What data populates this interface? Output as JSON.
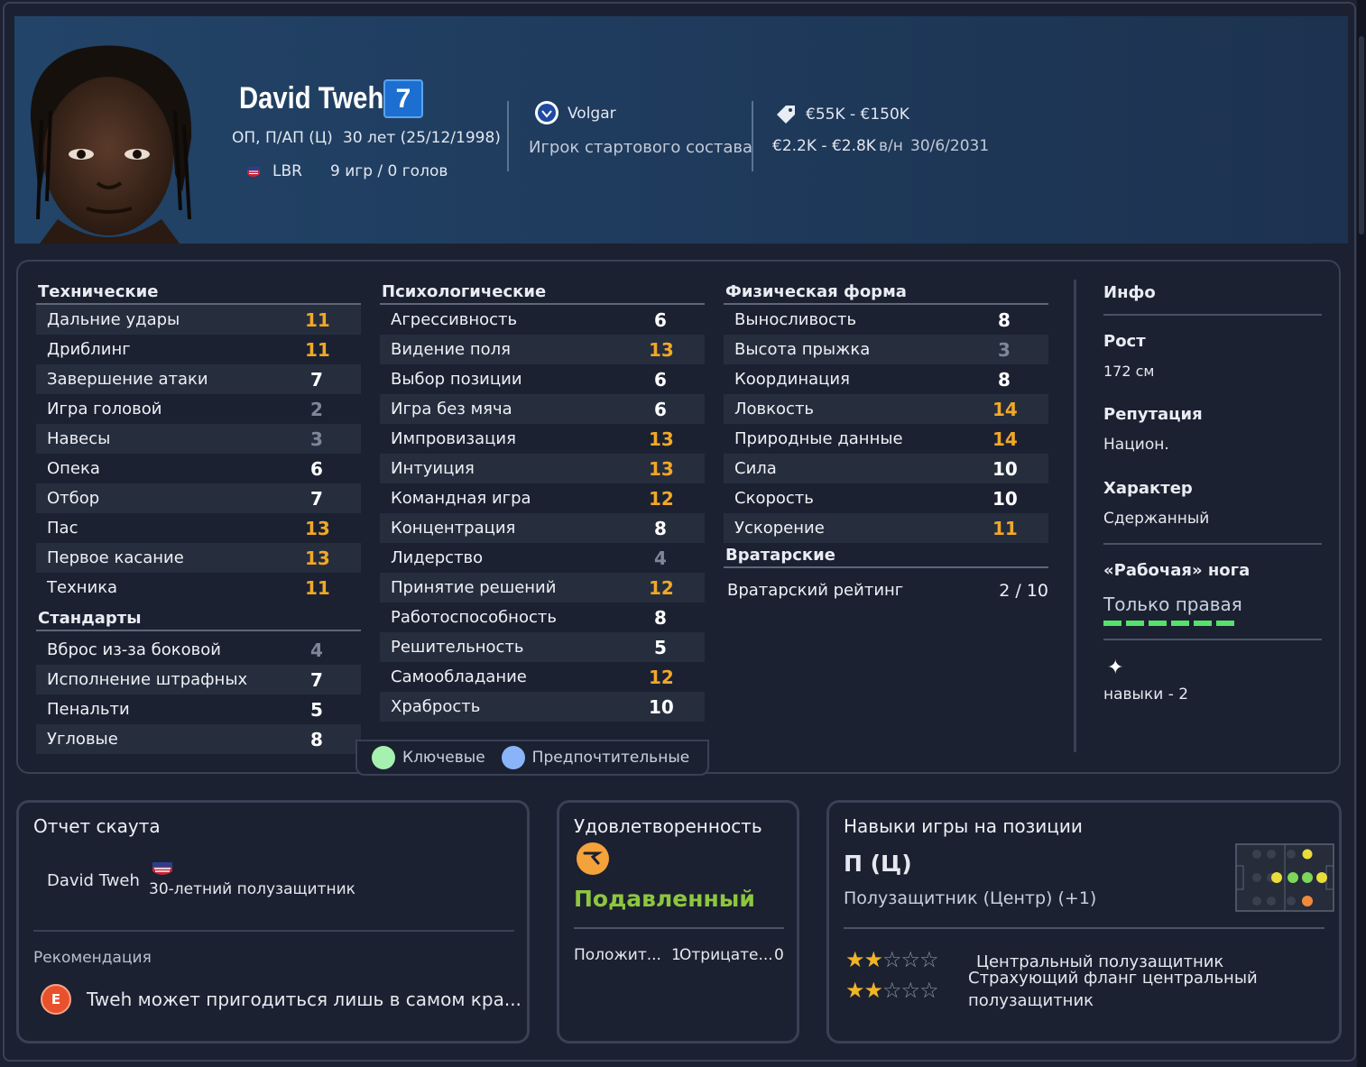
{
  "player": {
    "name": "David Tweh",
    "number": "7",
    "positions": "ОП, П/АП (Ц)",
    "age": "30 лет (25/12/1998)",
    "nation": "LBR",
    "apps": "9 игр / 0 голов",
    "club": "Volgar",
    "squad_status": "Игрок стартового состава",
    "value": "€55K - €150K",
    "wage": "€2.2K - €2.8K",
    "wage_suffix": "в/н",
    "contract_end": "30/6/2031"
  },
  "technical": {
    "title": "Технические",
    "items": [
      {
        "label": "Дальние удары",
        "value": "11",
        "tone": "o"
      },
      {
        "label": "Дриблинг",
        "value": "11",
        "tone": "o"
      },
      {
        "label": "Завершение атаки",
        "value": "7",
        "tone": "w"
      },
      {
        "label": "Игра головой",
        "value": "2",
        "tone": "g"
      },
      {
        "label": "Навесы",
        "value": "3",
        "tone": "g"
      },
      {
        "label": "Опека",
        "value": "6",
        "tone": "w"
      },
      {
        "label": "Отбор",
        "value": "7",
        "tone": "w"
      },
      {
        "label": "Пас",
        "value": "13",
        "tone": "o"
      },
      {
        "label": "Первое касание",
        "value": "13",
        "tone": "o"
      },
      {
        "label": "Техника",
        "value": "11",
        "tone": "o"
      }
    ]
  },
  "set_pieces": {
    "title": "Стандарты",
    "items": [
      {
        "label": "Вброс из-за боковой",
        "value": "4",
        "tone": "g"
      },
      {
        "label": "Исполнение штрафных",
        "value": "7",
        "tone": "w"
      },
      {
        "label": "Пенальти",
        "value": "5",
        "tone": "w"
      },
      {
        "label": "Угловые",
        "value": "8",
        "tone": "w"
      }
    ]
  },
  "mental": {
    "title": "Психологические",
    "items": [
      {
        "label": "Агрессивность",
        "value": "6",
        "tone": "w"
      },
      {
        "label": "Видение поля",
        "value": "13",
        "tone": "o"
      },
      {
        "label": "Выбор позиции",
        "value": "6",
        "tone": "w"
      },
      {
        "label": "Игра без мяча",
        "value": "6",
        "tone": "w"
      },
      {
        "label": "Импровизация",
        "value": "13",
        "tone": "o"
      },
      {
        "label": "Интуиция",
        "value": "13",
        "tone": "o"
      },
      {
        "label": "Командная игра",
        "value": "12",
        "tone": "o"
      },
      {
        "label": "Концентрация",
        "value": "8",
        "tone": "w"
      },
      {
        "label": "Лидерство",
        "value": "4",
        "tone": "g"
      },
      {
        "label": "Принятие решений",
        "value": "12",
        "tone": "o"
      },
      {
        "label": "Работоспособность",
        "value": "8",
        "tone": "w"
      },
      {
        "label": "Решительность",
        "value": "5",
        "tone": "w"
      },
      {
        "label": "Самообладание",
        "value": "12",
        "tone": "o"
      },
      {
        "label": "Храбрость",
        "value": "10",
        "tone": "w"
      }
    ]
  },
  "physical": {
    "title": "Физическая форма",
    "items": [
      {
        "label": "Выносливость",
        "value": "8",
        "tone": "w"
      },
      {
        "label": "Высота прыжка",
        "value": "3",
        "tone": "g"
      },
      {
        "label": "Координация",
        "value": "8",
        "tone": "w"
      },
      {
        "label": "Ловкость",
        "value": "14",
        "tone": "o"
      },
      {
        "label": "Природные данные",
        "value": "14",
        "tone": "o"
      },
      {
        "label": "Сила",
        "value": "10",
        "tone": "w"
      },
      {
        "label": "Скорость",
        "value": "10",
        "tone": "w"
      },
      {
        "label": "Ускорение",
        "value": "11",
        "tone": "o"
      }
    ]
  },
  "goalkeeping": {
    "title": "Вратарские",
    "rating_label": "Вратарский рейтинг",
    "rating_value": "2 / 10"
  },
  "legend": {
    "key": "Ключевые",
    "preferred": "Предпочтительные"
  },
  "info": {
    "title": "Инфо",
    "height_label": "Рост",
    "height_value": "172 см",
    "reputation_label": "Репутация",
    "reputation_value": "Национ.",
    "personality_label": "Характер",
    "personality_value": "Сдержанный",
    "foot_label": "«Рабочая» нога",
    "foot_value": "Только правая",
    "foot_level": 1.0,
    "skills": "навыки - 2"
  },
  "scout": {
    "title": "Отчет скаута",
    "name": "David Tweh",
    "desc": "30-летний полузащитник",
    "rec_label": "Рекомендация",
    "grade": "E",
    "rec_text": "Tweh может пригодиться лишь в самом кра..."
  },
  "happiness": {
    "title": "Удовлетворенность",
    "mood": "Подавленный",
    "positive_label": "Положит...",
    "positive_value": "1",
    "negative_label": "Отрицате...",
    "negative_value": "0"
  },
  "position": {
    "title": "Навыки игры на позиции",
    "code": "П (Ц)",
    "name": "Полузащитник (Центр) (+1)",
    "roles": [
      {
        "name": "Центральный полузащитник",
        "stars": 2
      },
      {
        "name": "Страхующий фланг центральный полузащитник",
        "stars": 2
      }
    ]
  },
  "colors": {
    "accent": "#f0a828",
    "key": "#a6f0b0",
    "preferred": "#8ab4f8",
    "mood": "#8dc63f"
  }
}
